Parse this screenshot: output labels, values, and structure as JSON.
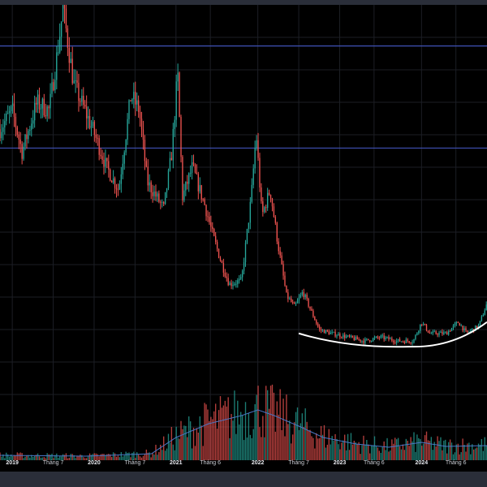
{
  "chart_data": {
    "type": "candlestick",
    "title": "",
    "xlabel": "",
    "ylabel": "",
    "x_ticks": [
      {
        "label": "2019",
        "t": 0.0
      },
      {
        "label": "Tháng 7",
        "t": 0.5
      },
      {
        "label": "2020",
        "t": 1.0
      },
      {
        "label": "Tháng 7",
        "t": 1.5
      },
      {
        "label": "2021",
        "t": 2.0
      },
      {
        "label": "Tháng 6",
        "t": 2.42
      },
      {
        "label": "2022",
        "t": 3.0
      },
      {
        "label": "Tháng 7",
        "t": 3.5
      },
      {
        "label": "2023",
        "t": 4.0
      },
      {
        "label": "Tháng 6",
        "t": 4.42
      },
      {
        "label": "2024",
        "t": 5.0
      },
      {
        "label": "Tháng 6",
        "t": 5.42
      }
    ],
    "x_range": [
      -0.15,
      5.8
    ],
    "price_range": [
      0,
      100
    ],
    "price_anchors": [
      {
        "t": -0.15,
        "p": 68
      },
      {
        "t": 0.0,
        "p": 73
      },
      {
        "t": 0.12,
        "p": 62
      },
      {
        "t": 0.3,
        "p": 75
      },
      {
        "t": 0.45,
        "p": 73
      },
      {
        "t": 0.55,
        "p": 88
      },
      {
        "t": 0.62,
        "p": 100
      },
      {
        "t": 0.75,
        "p": 80
      },
      {
        "t": 1.0,
        "p": 67
      },
      {
        "t": 1.15,
        "p": 58
      },
      {
        "t": 1.3,
        "p": 52
      },
      {
        "t": 1.45,
        "p": 77
      },
      {
        "t": 1.55,
        "p": 73
      },
      {
        "t": 1.65,
        "p": 54
      },
      {
        "t": 1.85,
        "p": 47
      },
      {
        "t": 1.95,
        "p": 62
      },
      {
        "t": 2.02,
        "p": 83
      },
      {
        "t": 2.08,
        "p": 50
      },
      {
        "t": 2.2,
        "p": 58
      },
      {
        "t": 2.35,
        "p": 48
      },
      {
        "t": 2.45,
        "p": 40
      },
      {
        "t": 2.55,
        "p": 33
      },
      {
        "t": 2.65,
        "p": 27
      },
      {
        "t": 2.8,
        "p": 28
      },
      {
        "t": 2.92,
        "p": 50
      },
      {
        "t": 2.98,
        "p": 67
      },
      {
        "t": 3.05,
        "p": 45
      },
      {
        "t": 3.15,
        "p": 52
      },
      {
        "t": 3.25,
        "p": 37
      },
      {
        "t": 3.35,
        "p": 24
      },
      {
        "t": 3.45,
        "p": 21
      },
      {
        "t": 3.55,
        "p": 25
      },
      {
        "t": 3.65,
        "p": 20
      },
      {
        "t": 3.75,
        "p": 15
      },
      {
        "t": 3.9,
        "p": 14
      },
      {
        "t": 4.1,
        "p": 13
      },
      {
        "t": 4.3,
        "p": 12
      },
      {
        "t": 4.5,
        "p": 13
      },
      {
        "t": 4.7,
        "p": 12
      },
      {
        "t": 4.9,
        "p": 12
      },
      {
        "t": 5.0,
        "p": 17
      },
      {
        "t": 5.1,
        "p": 14
      },
      {
        "t": 5.3,
        "p": 14
      },
      {
        "t": 5.45,
        "p": 17
      },
      {
        "t": 5.55,
        "p": 14
      },
      {
        "t": 5.7,
        "p": 16
      },
      {
        "t": 5.8,
        "p": 22
      }
    ],
    "volume_anchors": [
      {
        "t": -0.15,
        "v": 6
      },
      {
        "t": 0.9,
        "v": 5
      },
      {
        "t": 1.7,
        "v": 8
      },
      {
        "t": 2.0,
        "v": 28
      },
      {
        "t": 2.4,
        "v": 45
      },
      {
        "t": 2.8,
        "v": 55
      },
      {
        "t": 3.0,
        "v": 62
      },
      {
        "t": 3.2,
        "v": 55
      },
      {
        "t": 3.5,
        "v": 42
      },
      {
        "t": 3.8,
        "v": 28
      },
      {
        "t": 4.2,
        "v": 20
      },
      {
        "t": 4.6,
        "v": 16
      },
      {
        "t": 5.0,
        "v": 22
      },
      {
        "t": 5.3,
        "v": 17
      },
      {
        "t": 5.8,
        "v": 18
      }
    ],
    "volume_range": [
      0,
      120
    ],
    "horizontal_levels": [
      {
        "price": 90,
        "color": "#3f51b5"
      },
      {
        "price": 63,
        "color": "#3f51b5"
      }
    ],
    "arc_annotation": {
      "start": {
        "t": 3.5,
        "p": 14
      },
      "bottom": {
        "t": 4.85,
        "p": 10.5
      },
      "end": {
        "t": 5.8,
        "p": 17
      },
      "color": "#ffffff"
    },
    "candle_interval": 0.01923,
    "grid": true,
    "legend": "none"
  },
  "colors": {
    "up": "#26a69a",
    "down": "#ef5350",
    "background": "#000000",
    "grid": "#1c1e25",
    "level_line": "#3f51b5",
    "volume_ma": "#4a78c8",
    "chrome": "#2a2e39",
    "axis_text": "#c9ccd4"
  }
}
